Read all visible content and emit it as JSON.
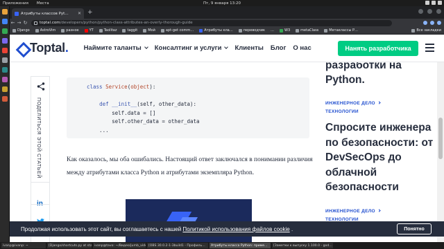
{
  "os": {
    "apps_label": "Приложения",
    "places_label": "Места",
    "clock": "Пт, 9 января  13:20"
  },
  "browser": {
    "tab_title": "Атрибуты классов Pyt…",
    "url_host": "toptal.com",
    "url_path": "/developers/python/python-class-attributes-an-overly-thorough-guide",
    "bookmarks": [
      "Django",
      "AstroVim",
      "разное",
      "YT",
      "Taolitaz",
      "taggit",
      "Мой",
      "apt-get comm…",
      "Атрибуты кла…",
      "переводчик",
      "…",
      "W3",
      "metaClass",
      "Метаклассы Р…"
    ],
    "other_bookmarks": "Все закладки"
  },
  "header": {
    "logo_text": "Toptal",
    "logo_dot": ".",
    "nav": [
      "Наймите таланты",
      "Консалтинг и услуги",
      "Клиенты",
      "Блог",
      "О нас"
    ],
    "cta": "Наняτь разработчика"
  },
  "share": {
    "label": "ПОДЕЛИТЬСЯ ЭТОЙ СТАТЬЕЙ"
  },
  "code": {
    "lines": [
      "class Service(object):",
      "",
      "    def __init__(self, other_data):",
      "        self.data = []",
      "        self.other_data = other_data",
      "    ..."
    ]
  },
  "article": {
    "paragraph": "Как оказалось, мы оба ошибались. Настоящий ответ заключался в понимании различия между атрибутами класса Python и атрибутами экземпляра Python."
  },
  "sidebar": {
    "top_title_tail": "разработки на Python.",
    "tag1": "ИНЖЕНЕРНОЕ ДЕЛО",
    "tag2": "ТЕХНОЛОГИИ",
    "article_title": "Спросите инженера по безопасности: от DevSecOps до облачной безопасности",
    "tag3": "ИНЖЕНЕРНОЕ ДЕЛО",
    "tag4": "ТЕХНОЛОГИИ"
  },
  "cookie": {
    "text_before": "Продолжая использовать этот сайт, вы соглашаетесь с нашей ",
    "link": "Политикой использования файлов cookie",
    "text_after": " .",
    "button": "Понятно"
  },
  "taskbar": {
    "items": [
      "ivanp@ivanp: ~",
      "[Django/shortcuts.py at sta…",
      "ivanp@tavo: ~/Видео/jumb_video",
      "[OBS 30.0.2-1-3build1 - Профиль…",
      "Атрибуты класса Python: приме…",
      "[Заметки к выпуску 1.100.0 - god…"
    ]
  },
  "colors": {
    "brand_blue": "#204ecf",
    "cta_green": "#00cc83",
    "text_dark": "#262d3d"
  }
}
